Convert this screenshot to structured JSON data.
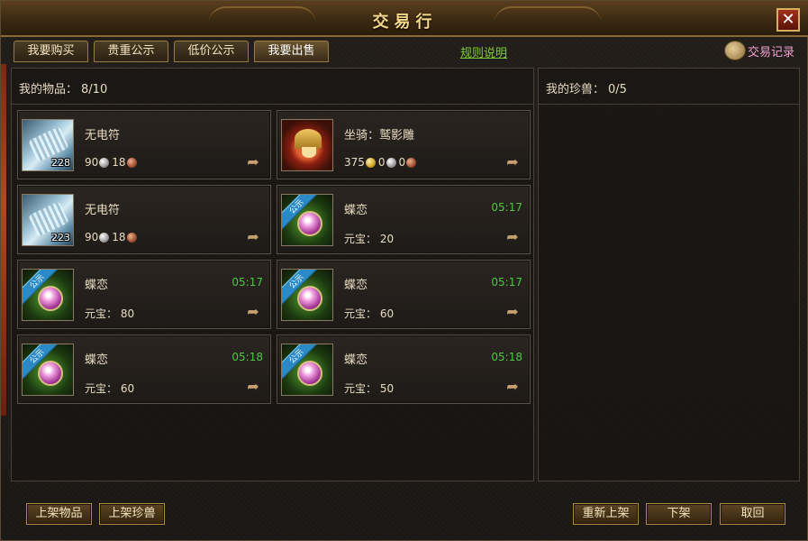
{
  "window": {
    "title": "交易行",
    "close_label": "✕"
  },
  "tabs": [
    {
      "label": "我要购买"
    },
    {
      "label": "贵重公示"
    },
    {
      "label": "低价公示"
    },
    {
      "label": "我要出售"
    }
  ],
  "rules_link": "规则说明",
  "trade_record": "交易记录",
  "items_panel": {
    "label": "我的物品：",
    "count": "8/10",
    "slots": [
      {
        "name": "无电符",
        "qty": "228",
        "icon": "scroll-icon",
        "price": {
          "a": "90",
          "b": "18"
        }
      },
      {
        "name": "坐骑：鹫影雕",
        "icon": "mount-icon",
        "price": {
          "a": "375",
          "b": "0",
          "c": "0"
        }
      },
      {
        "name": "无电符",
        "qty": "223",
        "icon": "scroll-icon",
        "price": {
          "a": "90",
          "b": "18"
        }
      },
      {
        "name": "蝶恋",
        "icon": "gem-icon",
        "ribbon": "公示",
        "timer": "05:17",
        "price_text": "元宝： 20"
      },
      {
        "name": "蝶恋",
        "icon": "gem-icon",
        "ribbon": "公示",
        "timer": "05:17",
        "price_text": "元宝： 80"
      },
      {
        "name": "蝶恋",
        "icon": "gem-icon",
        "ribbon": "公示",
        "timer": "05:17",
        "price_text": "元宝： 60"
      },
      {
        "name": "蝶恋",
        "icon": "gem-icon",
        "ribbon": "公示",
        "timer": "05:18",
        "price_text": "元宝： 60"
      },
      {
        "name": "蝶恋",
        "icon": "gem-icon",
        "ribbon": "公示",
        "timer": "05:18",
        "price_text": "元宝： 50"
      }
    ]
  },
  "pets_panel": {
    "label": "我的珍兽：",
    "count": "0/5"
  },
  "buttons": {
    "list_item": "上架物品",
    "list_pet": "上架珍兽",
    "relist": "重新上架",
    "delist": "下架",
    "cancel": "取回"
  },
  "colors": {
    "timer": "#4cc83c",
    "link": "#7ccc3a",
    "record": "#f0a0d0",
    "title": "#f5d98a"
  }
}
